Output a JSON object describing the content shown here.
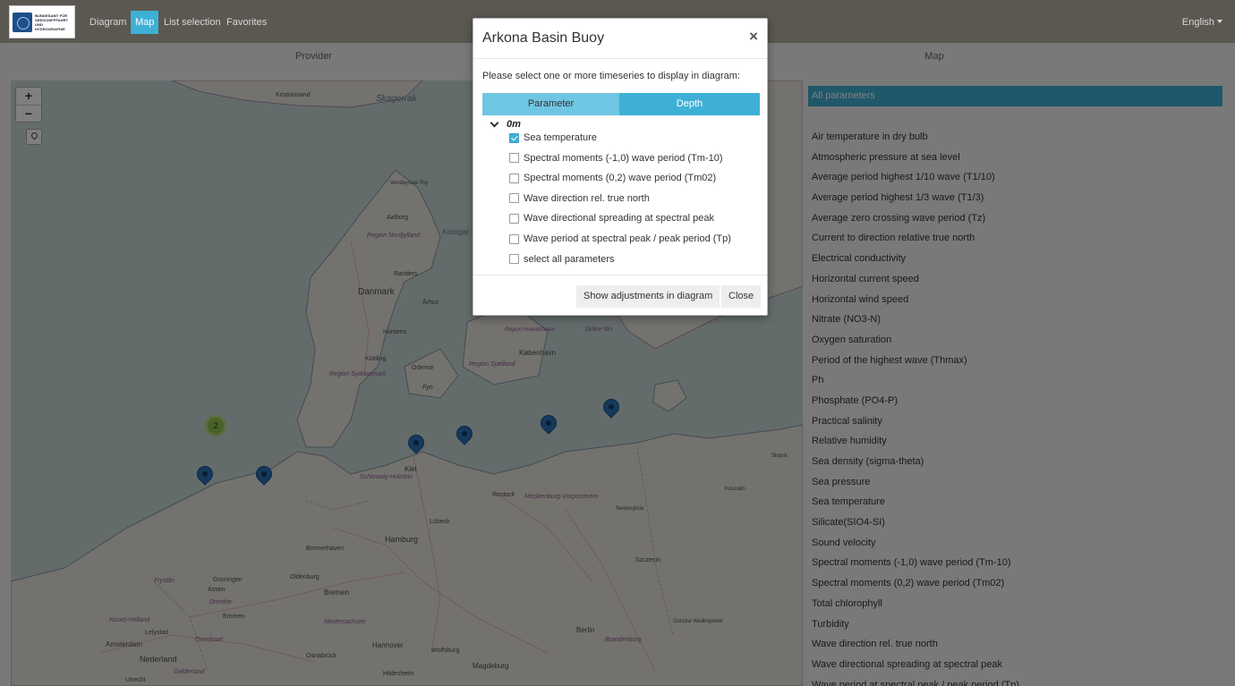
{
  "navbar": {
    "logo_text": "BUNDESAMT FÜR SEESCHIFFFAHRT UND HYDROGRAPHIE",
    "links": [
      "Diagram",
      "Map",
      "List selection",
      "Favorites"
    ],
    "active": "Map",
    "language": "English"
  },
  "columns": {
    "provider": "Provider",
    "map": "Map"
  },
  "map": {
    "zoom_in": "+",
    "zoom_out": "−",
    "cluster_count": "2",
    "labels": [
      "Skagerrak",
      "Kristiansand",
      "Vendsyssel-Thy",
      "Aalborg",
      "Region Nordjylland",
      "Kattegat",
      "Randers",
      "Danmark",
      "Århus",
      "Horsens",
      "Kolding",
      "Odense",
      "Region Syddanmark",
      "Fyn",
      "Region Sjælland",
      "København",
      "Region Hovedstaden",
      "Skåne län",
      "Kiel",
      "Schleswig-Holstein",
      "Rostock",
      "Mecklenburg-Vorpommern",
      "Lübeck",
      "Hamburg",
      "Bremerhaven",
      "Oldenburg",
      "Bremen",
      "Niedersachsen",
      "Groningen",
      "Drenthe",
      "Assen",
      "Emmen",
      "Amsterdam",
      "Nederland",
      "Overijssel",
      "Gelderland",
      "Utrecht",
      "Hannover",
      "Wolfsburg",
      "Osnabrück",
      "Hildesheim",
      "Magdeburg",
      "Berlin",
      "Brandenburg",
      "Szczecin",
      "Koszalin",
      "Słupsk",
      "Gorzów Wielkopolski",
      "Noord-Holland",
      "Fryslân",
      "Lelystad",
      "Swinoujście"
    ]
  },
  "parameters_panel": {
    "title": "All parameters",
    "items": [
      "Air temperature in dry bulb",
      "Atmospheric pressure at sea level",
      "Average period highest 1/10 wave (T1/10)",
      "Average period highest 1/3 wave (T1/3)",
      "Average zero crossing wave period (Tz)",
      "Current to direction relative true north",
      "Electrical conductivity",
      "Horizontal current speed",
      "Horizontal wind speed",
      "Nitrate (NO3-N)",
      "Oxygen saturation",
      "Period of the highest wave (Thmax)",
      "Ph",
      "Phosphate (PO4-P)",
      "Practical salinity",
      "Relative humidity",
      "Sea density (sigma-theta)",
      "Sea pressure",
      "Sea temperature",
      "Silicate(SIO4-SI)",
      "Sound velocity",
      "Spectral moments (-1,0) wave period (Tm-10)",
      "Spectral moments (0,2) wave period (Tm02)",
      "Total chlorophyll",
      "Turbidity",
      "Wave direction rel. true north",
      "Wave directional spreading at spectral peak",
      "Wave period at spectral peak / peak period (Tp)"
    ]
  },
  "modal": {
    "title": "Arkona Basin Buoy",
    "close_symbol": "×",
    "instructions": "Please select one or more timeseries to display in diagram:",
    "tabs": [
      "Parameter",
      "Depth"
    ],
    "active_tab": "Depth",
    "depth": "0m",
    "options": [
      {
        "label": "Sea temperature",
        "checked": true
      },
      {
        "label": "Spectral moments (-1,0) wave period (Tm-10)",
        "checked": false
      },
      {
        "label": "Spectral moments (0,2) wave period (Tm02)",
        "checked": false
      },
      {
        "label": "Wave direction rel. true north",
        "checked": false
      },
      {
        "label": "Wave directional spreading at spectral peak",
        "checked": false
      },
      {
        "label": "Wave period at spectral peak / peak period (Tp)",
        "checked": false
      },
      {
        "label": "select all parameters",
        "checked": false
      }
    ],
    "buttons": {
      "show_adjustments": "Show adjustments in diagram",
      "close": "Close"
    }
  },
  "colors": {
    "accent": "#3fb0d5",
    "navbar": "#5a5851",
    "marker": "#2b72b9"
  }
}
